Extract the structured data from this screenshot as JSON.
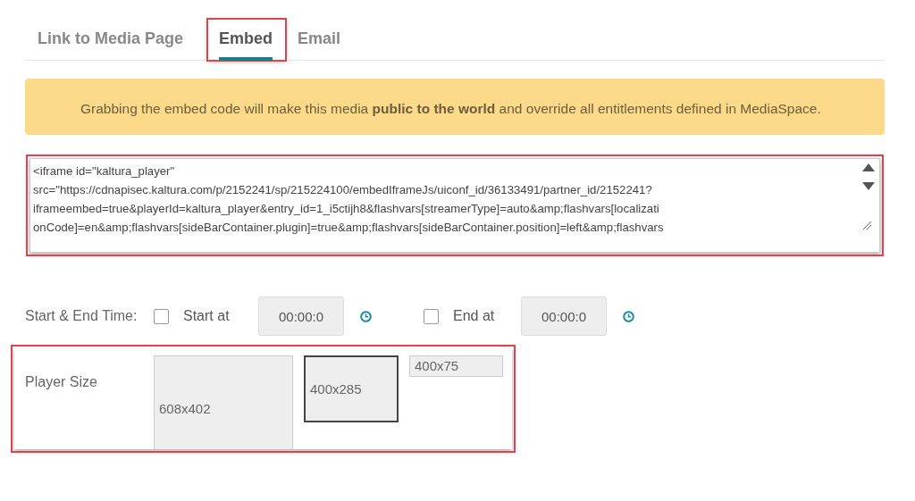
{
  "tabs": [
    {
      "label": "Link to Media Page",
      "selected": false,
      "highlighted": false
    },
    {
      "label": "Embed",
      "selected": true,
      "highlighted": true
    },
    {
      "label": "Email",
      "selected": false,
      "highlighted": false
    }
  ],
  "notice": "Grabbing the embed code will make this media **public to the world** and override all entitlements defined in MediaSpace.",
  "embed_code": {
    "highlighted": true,
    "lines": [
      "<iframe id=\"kaltura_player\"",
      "src=\"https://cdnapisec.kaltura.com/p/2152241/sp/215224100/embedIframeJs/uiconf_id/36133491/partner_id/2152241?",
      "iframeembed=true&playerId=kaltura_player&entry_id=1_i5ctijh8&flashvars[streamerType]=auto&amp;flashvars[localizati",
      "onCode]=en&amp;flashvars[sideBarContainer.plugin]=true&amp;flashvars[sideBarContainer.position]=left&amp;flashvars"
    ]
  },
  "time": {
    "label": "Start & End Time:",
    "fields": [
      {
        "label": "Start at",
        "checked": false,
        "value": "00:00:0"
      },
      {
        "label": "End at",
        "checked": false,
        "value": "00:00:0"
      }
    ]
  },
  "player_size": {
    "label": "Player Size",
    "highlighted": true,
    "options": [
      {
        "label": "608x402",
        "kind": "large",
        "selected": false
      },
      {
        "label": "400x285",
        "kind": "medium",
        "selected": true
      },
      {
        "label": "400x75",
        "kind": "small",
        "selected": false
      }
    ]
  }
}
